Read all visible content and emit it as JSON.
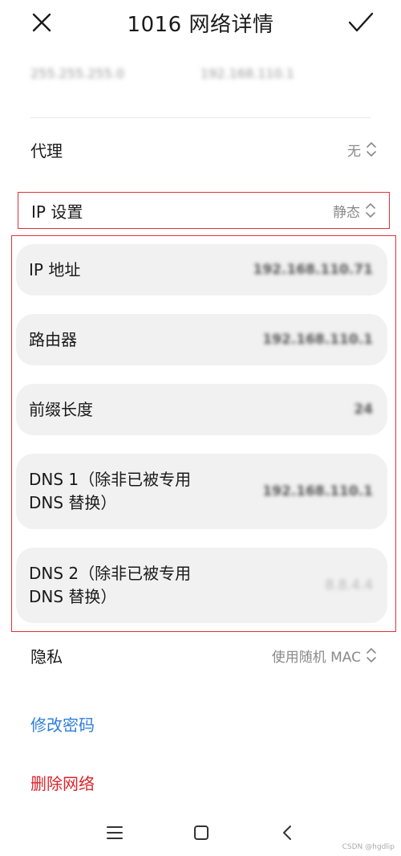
{
  "header": {
    "title": "1016 网络详情",
    "close_icon": "close-icon",
    "confirm_icon": "checkmark-icon"
  },
  "top_blurred": {
    "subnet_mask": "255.255.255.0",
    "gateway": "192.168.110.1"
  },
  "proxy": {
    "label": "代理",
    "value": "无"
  },
  "ip_settings": {
    "label": "IP 设置",
    "value": "静态"
  },
  "static_fields": [
    {
      "label": "IP 地址",
      "value": "192.168.110.71"
    },
    {
      "label": "路由器",
      "value": "192.168.110.1"
    },
    {
      "label": "前缀长度",
      "value": "24"
    },
    {
      "label_line1": "DNS 1（除非已被专用",
      "label_line2": "DNS 替换）",
      "value": "192.168.110.1"
    },
    {
      "label_line1": "DNS 2（除非已被专用",
      "label_line2": "DNS 替换）",
      "value": "8.8.4.4"
    }
  ],
  "privacy": {
    "label": "隐私",
    "value": "使用随机 MAC"
  },
  "actions": {
    "modify_password": "修改密码",
    "delete_network": "删除网络"
  },
  "navbar": {
    "menu_icon": "menu-icon",
    "home_icon": "home-icon",
    "back_icon": "back-icon"
  },
  "watermark": "CSDN @hgdlip",
  "colors": {
    "highlight": "#e0323a",
    "link_blue": "#2f7fd9",
    "link_red": "#d8262c",
    "card_bg": "#f1f1f1"
  }
}
